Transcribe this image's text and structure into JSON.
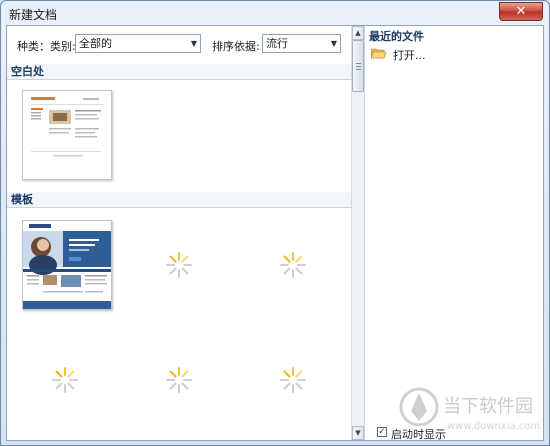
{
  "window": {
    "title": "新建文档",
    "close_glyph": "✕"
  },
  "filter": {
    "kind_label": "种类：类别:",
    "kind_value": "全部的",
    "sort_label": "排序依据:",
    "sort_value": "流行"
  },
  "sections": {
    "blank": "空白处",
    "templates": "模板"
  },
  "recent": {
    "header": "最近的文件",
    "open_label": "打开..."
  },
  "startup": {
    "label": "启动时显示",
    "checked": true
  },
  "watermark": {
    "text": "当下软件园",
    "url": "www.downxia.com"
  },
  "icons": [
    "close-icon",
    "chevron-down-icon",
    "loading-spinner-icon",
    "folder-open-icon",
    "checkbox-icon",
    "scroll-up-icon",
    "scroll-down-icon"
  ]
}
